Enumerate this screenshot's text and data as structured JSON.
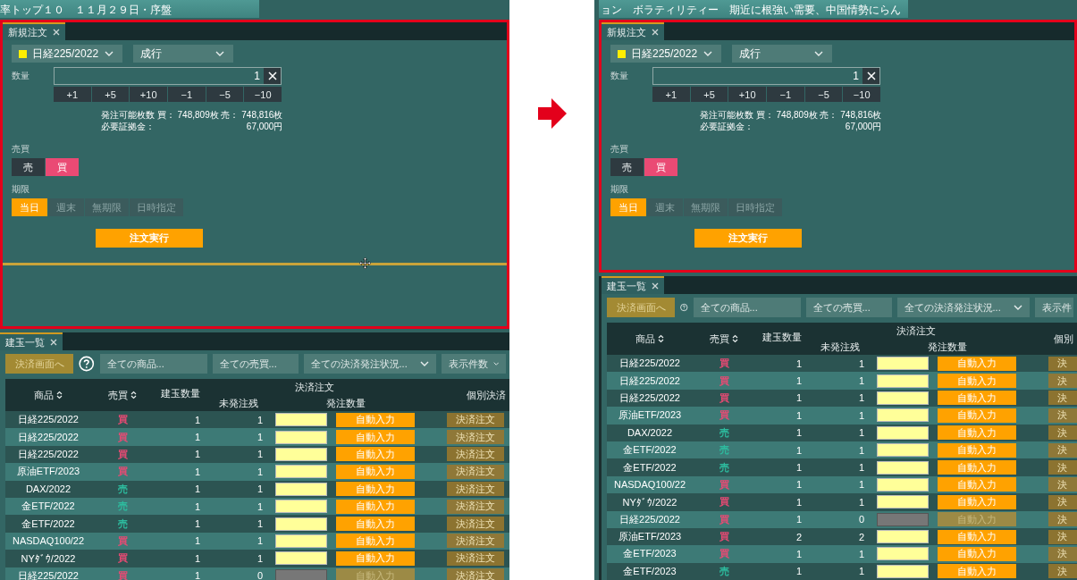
{
  "screens": [
    {
      "ticker": "率トップ１０　１１月２９日・序盤",
      "highlighted": true,
      "splitter": true,
      "order": {
        "tab": "新規注文",
        "product": {
          "label": "日経225/2022",
          "color": "#ffee00"
        },
        "order_type": "成行",
        "quantity_label": "数量",
        "quantity": "1",
        "steps": [
          "+1",
          "+5",
          "+10",
          "−1",
          "−5",
          "−10"
        ],
        "available": "発注可能枚数 買： 748,809枚 売： 748,816枚",
        "margin_label": "必要証拠金：",
        "margin_value": "67,000円",
        "side_label": "売買",
        "sides": [
          {
            "label": "売",
            "selected": false
          },
          {
            "label": "買",
            "selected": true
          }
        ],
        "term_label": "期限",
        "terms": [
          {
            "label": "当日",
            "selected": true
          },
          {
            "label": "週末",
            "selected": false
          },
          {
            "label": "無期限",
            "selected": false
          },
          {
            "label": "日時指定",
            "selected": false
          }
        ],
        "submit": "注文実行"
      },
      "positions": {
        "tab": "建玉一覧",
        "settle_button": "決済画面へ",
        "filters": [
          {
            "label": "全ての商品...",
            "kind": "field"
          },
          {
            "label": "全ての売買...",
            "kind": "field"
          },
          {
            "label": "全ての決済発注状況...",
            "kind": "dropdown"
          },
          {
            "label": "表示件数",
            "kind": "dropdown"
          }
        ],
        "header": {
          "group": "決済注文",
          "columns": [
            {
              "label": "商品",
              "sortable": true
            },
            {
              "label": "売買",
              "sortable": true
            },
            {
              "label": "建玉数量",
              "sortable": false
            },
            {
              "label": "未発注残",
              "sortable": false
            },
            {
              "label": "発注数量",
              "sortable": false
            },
            {
              "label": "個別決済",
              "sortable": false
            }
          ]
        },
        "rows": [
          {
            "product": "日経225/2022",
            "side": "買",
            "kind": "buy",
            "quantity": "1",
            "remaining": "1",
            "disabled": false,
            "auto": "自動入力",
            "settle": "決済注文"
          },
          {
            "product": "日経225/2022",
            "side": "買",
            "kind": "buy",
            "quantity": "1",
            "remaining": "1",
            "disabled": false,
            "auto": "自動入力",
            "settle": "決済注文"
          },
          {
            "product": "日経225/2022",
            "side": "買",
            "kind": "buy",
            "quantity": "1",
            "remaining": "1",
            "disabled": false,
            "auto": "自動入力",
            "settle": "決済注文"
          },
          {
            "product": "原油ETF/2023",
            "side": "買",
            "kind": "buy",
            "quantity": "1",
            "remaining": "1",
            "disabled": false,
            "auto": "自動入力",
            "settle": "決済注文"
          },
          {
            "product": "DAX/2022",
            "side": "売",
            "kind": "sell",
            "quantity": "1",
            "remaining": "1",
            "disabled": false,
            "auto": "自動入力",
            "settle": "決済注文"
          },
          {
            "product": "金ETF/2022",
            "side": "売",
            "kind": "sell",
            "quantity": "1",
            "remaining": "1",
            "disabled": false,
            "auto": "自動入力",
            "settle": "決済注文"
          },
          {
            "product": "金ETF/2022",
            "side": "売",
            "kind": "sell",
            "quantity": "1",
            "remaining": "1",
            "disabled": false,
            "auto": "自動入力",
            "settle": "決済注文"
          },
          {
            "product": "NASDAQ100/22",
            "side": "買",
            "kind": "buy",
            "quantity": "1",
            "remaining": "1",
            "disabled": false,
            "auto": "自動入力",
            "settle": "決済注文"
          },
          {
            "product": "NYﾀﾞｳ/2022",
            "side": "買",
            "kind": "buy",
            "quantity": "1",
            "remaining": "1",
            "disabled": false,
            "auto": "自動入力",
            "settle": "決済注文"
          },
          {
            "product": "日経225/2022",
            "side": "買",
            "kind": "buy",
            "quantity": "1",
            "remaining": "0",
            "disabled": true,
            "auto": "自動入力",
            "settle": "決済注文"
          }
        ]
      }
    },
    {
      "ticker": "ョン　ボラティリティー　期近に根強い需要、中国情勢にらん",
      "highlighted": true,
      "splitter": false,
      "order": {
        "tab": "新規注文",
        "product": {
          "label": "日経225/2022",
          "color": "#ffee00"
        },
        "order_type": "成行",
        "quantity_label": "数量",
        "quantity": "1",
        "steps": [
          "+1",
          "+5",
          "+10",
          "−1",
          "−5",
          "−10"
        ],
        "available": "発注可能枚数 買： 748,809枚 売： 748,816枚",
        "margin_label": "必要証拠金：",
        "margin_value": "67,000円",
        "side_label": "売買",
        "sides": [
          {
            "label": "売",
            "selected": false
          },
          {
            "label": "買",
            "selected": true
          }
        ],
        "term_label": "期限",
        "terms": [
          {
            "label": "当日",
            "selected": true
          },
          {
            "label": "週末",
            "selected": false
          },
          {
            "label": "無期限",
            "selected": false
          },
          {
            "label": "日時指定",
            "selected": false
          }
        ],
        "submit": "注文実行"
      },
      "positions": {
        "tab": "建玉一覧",
        "settle_button": "決済画面へ",
        "filters": [
          {
            "label": "全ての商品...",
            "kind": "field"
          },
          {
            "label": "全ての売買...",
            "kind": "field"
          },
          {
            "label": "全ての決済発注状況...",
            "kind": "dropdown"
          },
          {
            "label": "表示件",
            "kind": "field"
          }
        ],
        "header": {
          "group": "決済注文",
          "columns": [
            {
              "label": "商品",
              "sortable": true
            },
            {
              "label": "売買",
              "sortable": true
            },
            {
              "label": "建玉数量",
              "sortable": false
            },
            {
              "label": "未発注残",
              "sortable": false
            },
            {
              "label": "発注数量",
              "sortable": false
            },
            {
              "label": "個別",
              "sortable": false
            }
          ]
        },
        "rows": [
          {
            "product": "日経225/2022",
            "side": "買",
            "kind": "buy",
            "quantity": "1",
            "remaining": "1",
            "disabled": false,
            "auto": "自動入力",
            "settle": "決"
          },
          {
            "product": "日経225/2022",
            "side": "買",
            "kind": "buy",
            "quantity": "1",
            "remaining": "1",
            "disabled": false,
            "auto": "自動入力",
            "settle": "決"
          },
          {
            "product": "日経225/2022",
            "side": "買",
            "kind": "buy",
            "quantity": "1",
            "remaining": "1",
            "disabled": false,
            "auto": "自動入力",
            "settle": "決"
          },
          {
            "product": "原油ETF/2023",
            "side": "買",
            "kind": "buy",
            "quantity": "1",
            "remaining": "1",
            "disabled": false,
            "auto": "自動入力",
            "settle": "決"
          },
          {
            "product": "DAX/2022",
            "side": "売",
            "kind": "sell",
            "quantity": "1",
            "remaining": "1",
            "disabled": false,
            "auto": "自動入力",
            "settle": "決"
          },
          {
            "product": "金ETF/2022",
            "side": "売",
            "kind": "sell",
            "quantity": "1",
            "remaining": "1",
            "disabled": false,
            "auto": "自動入力",
            "settle": "決"
          },
          {
            "product": "金ETF/2022",
            "side": "売",
            "kind": "sell",
            "quantity": "1",
            "remaining": "1",
            "disabled": false,
            "auto": "自動入力",
            "settle": "決"
          },
          {
            "product": "NASDAQ100/22",
            "side": "買",
            "kind": "buy",
            "quantity": "1",
            "remaining": "1",
            "disabled": false,
            "auto": "自動入力",
            "settle": "決"
          },
          {
            "product": "NYﾀﾞｳ/2022",
            "side": "買",
            "kind": "buy",
            "quantity": "1",
            "remaining": "1",
            "disabled": false,
            "auto": "自動入力",
            "settle": "決"
          },
          {
            "product": "日経225/2022",
            "side": "買",
            "kind": "buy",
            "quantity": "1",
            "remaining": "0",
            "disabled": true,
            "auto": "自動入力",
            "settle": "決"
          },
          {
            "product": "原油ETF/2023",
            "side": "買",
            "kind": "buy",
            "quantity": "2",
            "remaining": "2",
            "disabled": false,
            "auto": "自動入力",
            "settle": "決"
          },
          {
            "product": "金ETF/2023",
            "side": "買",
            "kind": "buy",
            "quantity": "1",
            "remaining": "1",
            "disabled": false,
            "auto": "自動入力",
            "settle": "決"
          },
          {
            "product": "金ETF/2023",
            "side": "売",
            "kind": "sell",
            "quantity": "1",
            "remaining": "1",
            "disabled": false,
            "auto": "自動入力",
            "settle": "決"
          }
        ]
      }
    }
  ]
}
